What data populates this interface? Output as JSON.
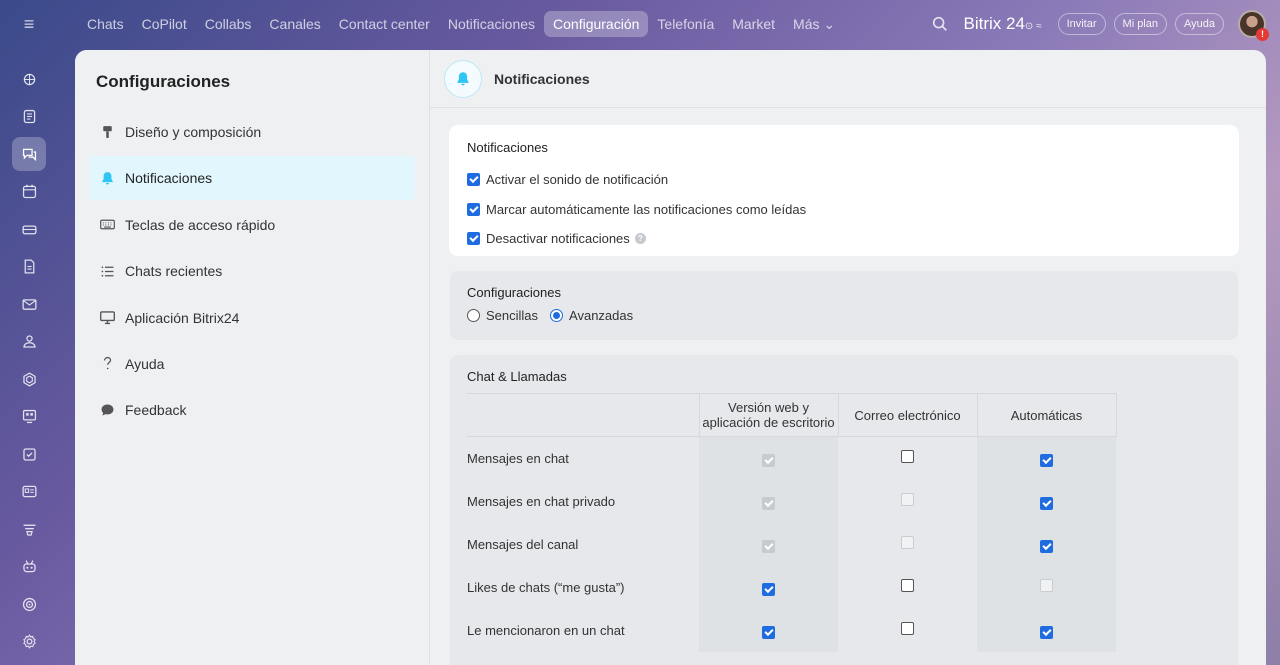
{
  "topbar": {
    "nav": [
      {
        "label": "Chats",
        "active": false
      },
      {
        "label": "CoPilot",
        "active": false
      },
      {
        "label": "Collabs",
        "active": false
      },
      {
        "label": "Canales",
        "active": false
      },
      {
        "label": "Contact center",
        "active": false
      },
      {
        "label": "Notificaciones",
        "active": false
      },
      {
        "label": "Configuración",
        "active": true
      },
      {
        "label": "Telefonía",
        "active": false
      },
      {
        "label": "Market",
        "active": false
      },
      {
        "label": "Más ⌄",
        "active": false
      }
    ],
    "brand": "Bitrix 24",
    "brand_suffix": "⊙ ≈",
    "invite_label": "Invitar",
    "plan_label": "Mi plan",
    "help_label": "Ayuda",
    "avatar_badge": "!"
  },
  "rail_icons": [
    "copilot-icon",
    "feed-icon",
    "chat-icon",
    "calendar-icon",
    "drive-icon",
    "docs-icon",
    "mail-icon",
    "groups-icon",
    "hexagon-icon",
    "board-icon",
    "tasks-icon",
    "crm-icon",
    "filter-icon",
    "robot-icon",
    "target-icon",
    "settings-icon"
  ],
  "sidebar": {
    "title": "Configuraciones",
    "items": [
      {
        "label": "Diseño y composición",
        "icon": "brush-icon",
        "active": false
      },
      {
        "label": "Notificaciones",
        "icon": "bell-icon",
        "active": true
      },
      {
        "label": "Teclas de acceso rápido",
        "icon": "keyboard-icon",
        "active": false
      },
      {
        "label": "Chats recientes",
        "icon": "list-icon",
        "active": false
      },
      {
        "label": "Aplicación Bitrix24",
        "icon": "monitor-icon",
        "active": false
      },
      {
        "label": "Ayuda",
        "icon": "question-icon",
        "active": false
      },
      {
        "label": "Feedback",
        "icon": "speech-bubble-icon",
        "active": false
      }
    ]
  },
  "content": {
    "header_title": "Notificaciones",
    "notif_card": {
      "title": "Notificaciones",
      "options": [
        {
          "label": "Activar el sonido de notificación",
          "checked": true,
          "help": false
        },
        {
          "label": "Marcar automáticamente las notificaciones como leídas",
          "checked": true,
          "help": false
        },
        {
          "label": "Desactivar notificaciones",
          "checked": true,
          "help": true
        }
      ]
    },
    "config_card": {
      "title": "Configuraciones",
      "radio_simple": "Sencillas",
      "radio_advanced": "Avanzadas",
      "selected": "advanced"
    },
    "chat_card": {
      "title": "Chat & Llamadas",
      "columns": {
        "web_line1": "Versión web y",
        "web_line2": "aplicación de escritorio",
        "email": "Correo electrónico",
        "auto": "Automáticas"
      },
      "rows": [
        {
          "label": "Mensajes en chat",
          "web": "dis-on",
          "email": "off",
          "auto": "on"
        },
        {
          "label": "Mensajes en chat privado",
          "web": "dis-on",
          "email": "dis-off",
          "auto": "on"
        },
        {
          "label": "Mensajes del canal",
          "web": "dis-on",
          "email": "dis-off",
          "auto": "on"
        },
        {
          "label": "Likes de chats (“me gusta”)",
          "web": "on",
          "email": "off",
          "auto": "dis-off"
        },
        {
          "label": "Le mencionaron en un chat",
          "web": "on",
          "email": "off",
          "auto": "on"
        }
      ]
    }
  }
}
